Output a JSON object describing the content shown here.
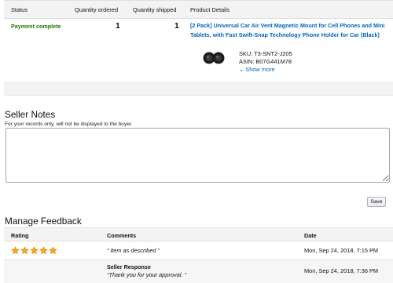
{
  "order_table": {
    "headers": {
      "status": "Status",
      "quantity_ordered": "Quantity ordered",
      "quantity_shipped": "Quantity shipped",
      "product_details": "Product Details"
    },
    "row": {
      "status": "Payment complete",
      "quantity_ordered": "1",
      "quantity_shipped": "1",
      "product_title": "[2 Pack] Universal Car Air Vent Magnetic Mount for Cell Phones and Mini Tablets, with Fast Swift-Snap Technology Phone Holder for Car (Black)",
      "sku": "SKU:  T3-SNT2-J205",
      "asin": "ASIN:  B07G441M78",
      "show_more": "Show more"
    }
  },
  "seller_notes": {
    "title": "Seller Notes",
    "subtitle": "For your records only, will not be displayed to the buyer.",
    "value": "",
    "save_label": "Save"
  },
  "feedback": {
    "title": "Manage Feedback",
    "headers": {
      "rating": "Rating",
      "comments": "Comments",
      "date": "Date"
    },
    "rating_stars": 5,
    "star_color": "#ffa41c",
    "entries": [
      {
        "comment": "“ item as described ”",
        "date": "Mon, Sep 24, 2018, 7:15 PM"
      }
    ],
    "seller_response": {
      "label": "Seller Response",
      "text": "“Thank you for your approval. ”",
      "date": "Mon, Sep 24, 2018, 7:36 PM"
    }
  },
  "colors": {
    "status_green": "#237a00",
    "link_blue": "#0066c0",
    "header_gray": "#f3f3f3"
  }
}
